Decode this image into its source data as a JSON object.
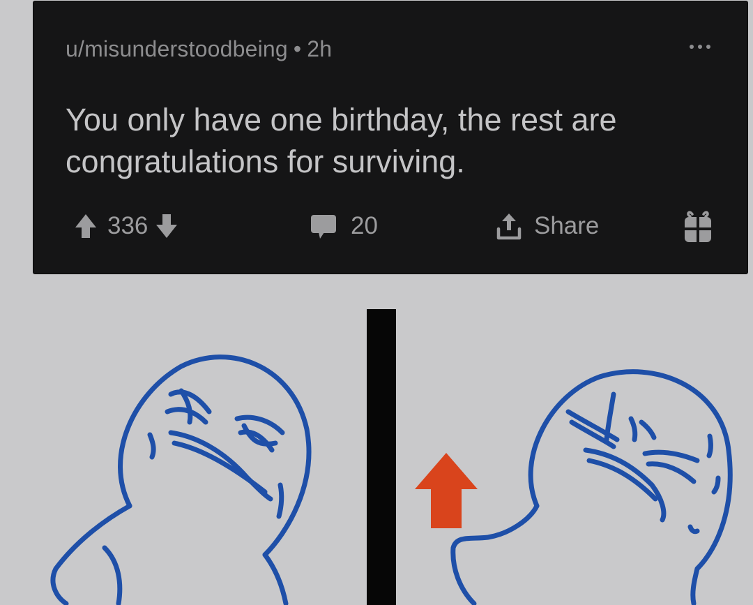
{
  "post": {
    "username": "u/misunderstoodbeing",
    "separator": "•",
    "age": "2h",
    "title": "You only have one birthday, the rest are congratulations for surviving.",
    "upvotes": "336",
    "comments": "20",
    "share_label": "Share"
  },
  "icons": {
    "more": "more-horizontal-icon",
    "upvote": "upvote-arrow-icon",
    "downvote": "downvote-arrow-icon",
    "comment": "comment-bubble-icon",
    "share": "share-upload-icon",
    "award": "gift-award-icon"
  },
  "colors": {
    "background": "#c9c9cb",
    "card": "#151516",
    "meta_text": "#8d8d8f",
    "title_text": "#c4c4c6",
    "stroke_blue": "#1e4fa8",
    "upvote_orange": "#d9441c"
  }
}
